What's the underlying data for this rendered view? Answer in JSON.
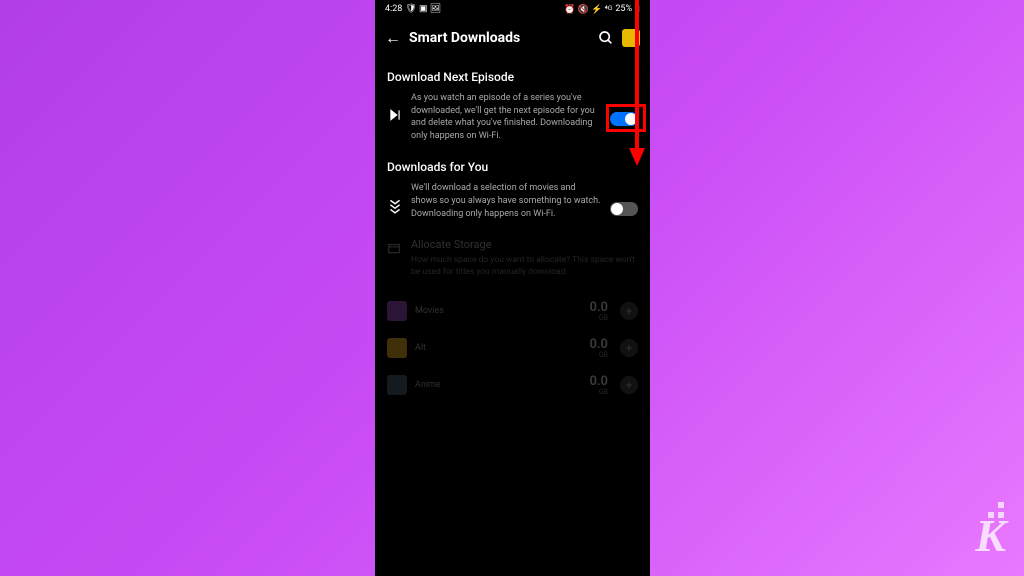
{
  "status": {
    "time": "4:28",
    "left_icons": "🛡 ▣ 🖼",
    "right_icons": "⏰ 🔇 ⚡ ⁴ᴳ",
    "battery": "25%"
  },
  "header": {
    "title": "Smart Downloads"
  },
  "sections": {
    "next_episode": {
      "title": "Download Next Episode",
      "description": "As you watch an episode of a series you've downloaded, we'll get the next episode for you and delete what you've finished. Downloading only happens on Wi-Fi.",
      "toggle_on": true
    },
    "for_you": {
      "title": "Downloads for You",
      "description": "We'll download a selection of movies and shows so you always have something to watch. Downloading only happens on Wi-Fi.",
      "toggle_on": false
    },
    "allocate": {
      "title": "Allocate Storage",
      "description": "How much space do you want to allocate? This space won't be used for titles you manually download."
    }
  },
  "storage": [
    {
      "name": "Movies",
      "value": "0.0",
      "unit": "GB",
      "thumb_color": "#7a3c9c"
    },
    {
      "name": "Alt",
      "value": "0.0",
      "unit": "GB",
      "thumb_color": "#b58a1a"
    },
    {
      "name": "Anime",
      "value": "0.0",
      "unit": "GB",
      "thumb_color": "#3c4a5c"
    }
  ],
  "watermark": "K"
}
